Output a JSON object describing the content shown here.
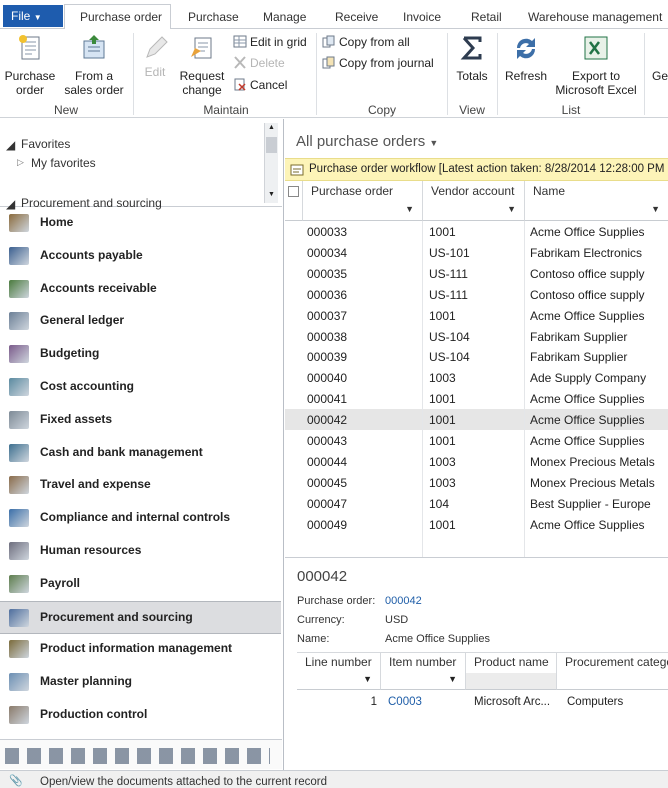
{
  "tabs": {
    "file": "File",
    "items": [
      "Purchase order",
      "Purchase",
      "Manage",
      "Receive",
      "Invoice",
      "Retail",
      "Warehouse management"
    ]
  },
  "ribbon": {
    "purchase_order": "Purchase order",
    "from_sales_order": "From a sales order",
    "edit": "Edit",
    "request_change": "Request change",
    "edit_in_grid": "Edit in grid",
    "delete": "Delete",
    "cancel": "Cancel",
    "copy_from_all": "Copy from all",
    "copy_from_journal": "Copy from journal",
    "totals": "Totals",
    "refresh": "Refresh",
    "export_excel": "Export to Microsoft Excel",
    "next_cut": "Ge",
    "groups": {
      "new": "New",
      "maintain": "Maintain",
      "copy": "Copy",
      "view": "View",
      "list": "List"
    }
  },
  "nav": {
    "favorites": "Favorites",
    "my_favorites": "My favorites",
    "procurement_header": "Procurement and sourcing",
    "modules": [
      "Home",
      "Accounts payable",
      "Accounts receivable",
      "General ledger",
      "Budgeting",
      "Cost accounting",
      "Fixed assets",
      "Cash and bank management",
      "Travel and expense",
      "Compliance and internal controls",
      "Human resources",
      "Payroll",
      "Procurement and sourcing",
      "Product information management",
      "Master planning",
      "Production control"
    ],
    "selected": "Procurement and sourcing"
  },
  "list": {
    "title": "All purchase orders",
    "workflow": "Purchase order workflow  [Latest action taken: 8/28/2014 12:28:00 PM",
    "columns": [
      "Purchase order",
      "Vendor account",
      "Name"
    ],
    "rows": [
      [
        "000033",
        "1001",
        "Acme Office Supplies"
      ],
      [
        "000034",
        "US-101",
        "Fabrikam Electronics"
      ],
      [
        "000035",
        "US-111",
        "Contoso office supply"
      ],
      [
        "000036",
        "US-111",
        "Contoso office supply"
      ],
      [
        "000037",
        "1001",
        "Acme Office Supplies"
      ],
      [
        "000038",
        "US-104",
        "Fabrikam Supplier"
      ],
      [
        "000039",
        "US-104",
        "Fabrikam Supplier"
      ],
      [
        "000040",
        "1003",
        "Ade Supply Company"
      ],
      [
        "000041",
        "1001",
        "Acme Office Supplies"
      ],
      [
        "000042",
        "1001",
        "Acme Office Supplies"
      ],
      [
        "000043",
        "1001",
        "Acme Office Supplies"
      ],
      [
        "000044",
        "1003",
        "Monex Precious Metals"
      ],
      [
        "000045",
        "1003",
        "Monex Precious Metals"
      ],
      [
        "000047",
        "104",
        "Best Supplier - Europe"
      ],
      [
        "000049",
        "1001",
        "Acme Office Supplies"
      ]
    ],
    "selected_row": "000042"
  },
  "detail": {
    "heading": "000042",
    "po_label": "Purchase order:",
    "po_value": "000042",
    "currency_label": "Currency:",
    "currency_value": "USD",
    "name_label": "Name:",
    "name_value": "Acme Office Supplies",
    "line_columns": [
      "Line number",
      "Item number",
      "Product name",
      "Procurement category"
    ],
    "line": [
      "1",
      "C0003",
      "Microsoft Arc...",
      "Computers"
    ]
  },
  "status": "Open/view the documents attached to the current record"
}
